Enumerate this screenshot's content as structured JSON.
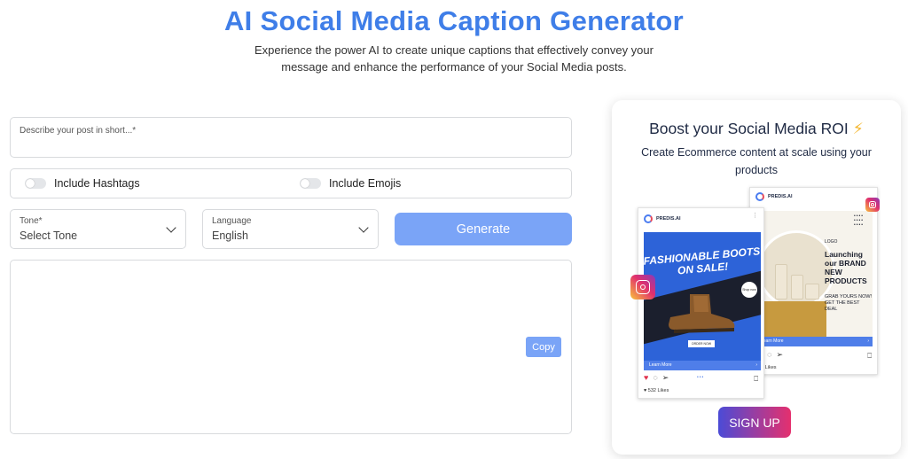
{
  "header": {
    "title": "AI Social Media Caption Generator",
    "subtitle": "Experience the power AI to create unique captions that effectively convey your message and enhance the performance of your Social Media posts."
  },
  "form": {
    "describe_placeholder": "Describe your post in short...*",
    "include_hashtags_label": "Include Hashtags",
    "include_hashtags_on": false,
    "include_emojis_label": "Include Emojis",
    "include_emojis_on": false,
    "tone": {
      "label": "Tone*",
      "value": "Select Tone"
    },
    "language": {
      "label": "Language",
      "value": "English"
    },
    "generate_label": "Generate",
    "copy_label": "Copy"
  },
  "promo": {
    "title": "Boost your Social Media ROI",
    "title_icon": "⚡",
    "text": "Create Ecommerce content at scale using your products",
    "signup_label": "SIGN UP",
    "post_front": {
      "brand": "PREDIS.AI",
      "headline": "FASHIONABLE BOOTS ON SALE!",
      "sticker": "Shop now",
      "buy": "ORDER NOW",
      "learn_more": "Learn More",
      "likes": "♥ 532 Likes"
    },
    "post_back": {
      "brand": "PREDIS.AI",
      "small": "LOGO",
      "headline": "Launching our BRAND NEW PRODUCTS",
      "grab": "GRAB YOURS NOW! GET THE BEST DEAL",
      "learn_more": "Learn More",
      "likes": "532 Likes"
    }
  },
  "colors": {
    "title": "#3f7ee8",
    "button": "#7aa4f7",
    "signup_gradient": [
      "#4b4bd6",
      "#e5306e"
    ]
  }
}
